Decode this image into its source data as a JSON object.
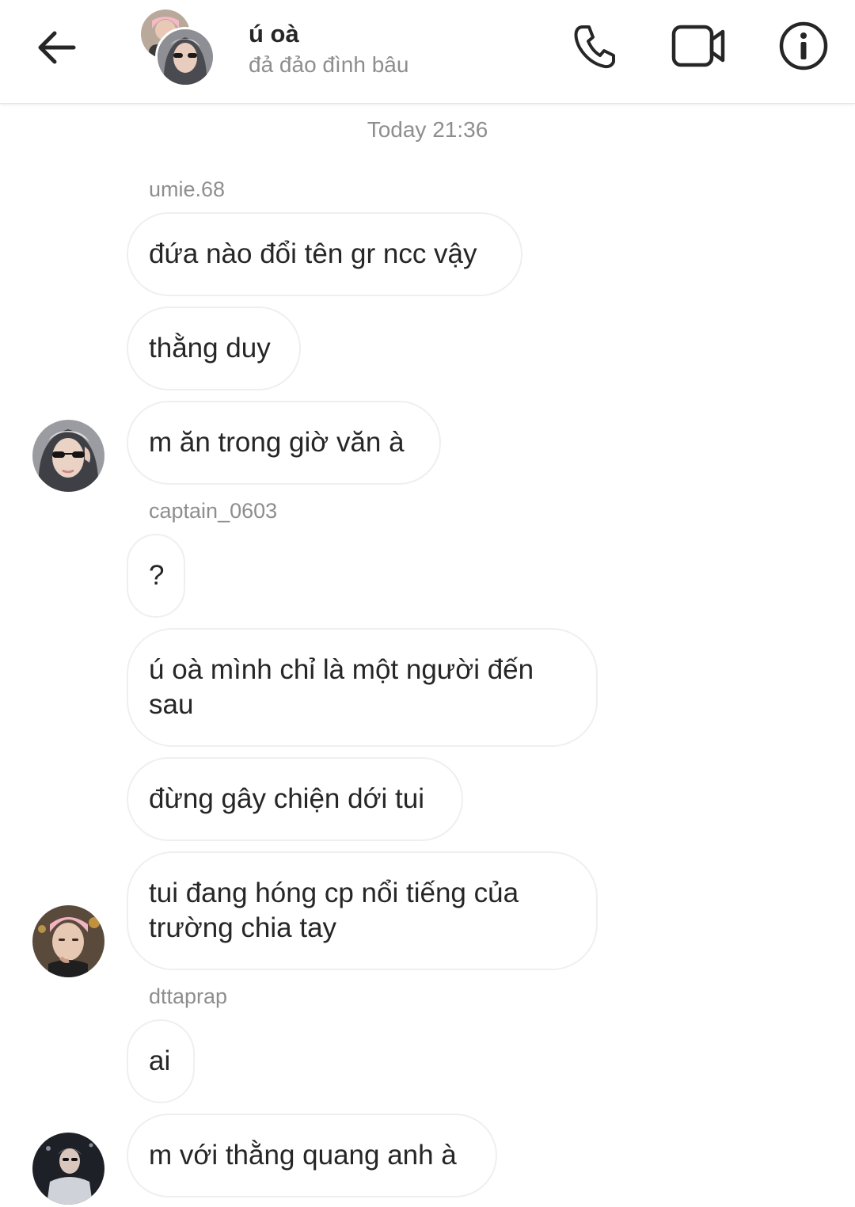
{
  "header": {
    "back_icon": "arrow-left-icon",
    "title": "ú oà",
    "subtitle": "đả đảo đình bâu",
    "phone_icon": "phone-icon",
    "video_icon": "video-camera-icon",
    "info_icon": "info-icon"
  },
  "conversation": {
    "timestamp": "Today 21:36",
    "groups": [
      {
        "sender": "umie.68",
        "messages": [
          "đứa nào đổi tên gr ncc vậy",
          "thằng duy",
          "m ăn trong giờ văn à"
        ]
      },
      {
        "sender": "captain_0603",
        "messages": [
          "?",
          "ú oà mình chỉ là một người đến sau",
          "đừng gây chiện dới tui",
          "tui đang hóng cp nổi tiếng của trường chia tay"
        ]
      },
      {
        "sender": "dttaprap",
        "messages": [
          "ai",
          "m với thằng quang anh à"
        ]
      }
    ]
  },
  "colors": {
    "text": "#262626",
    "secondary_text": "#8e8e8e",
    "bubble_border": "#efefef",
    "background": "#ffffff"
  }
}
